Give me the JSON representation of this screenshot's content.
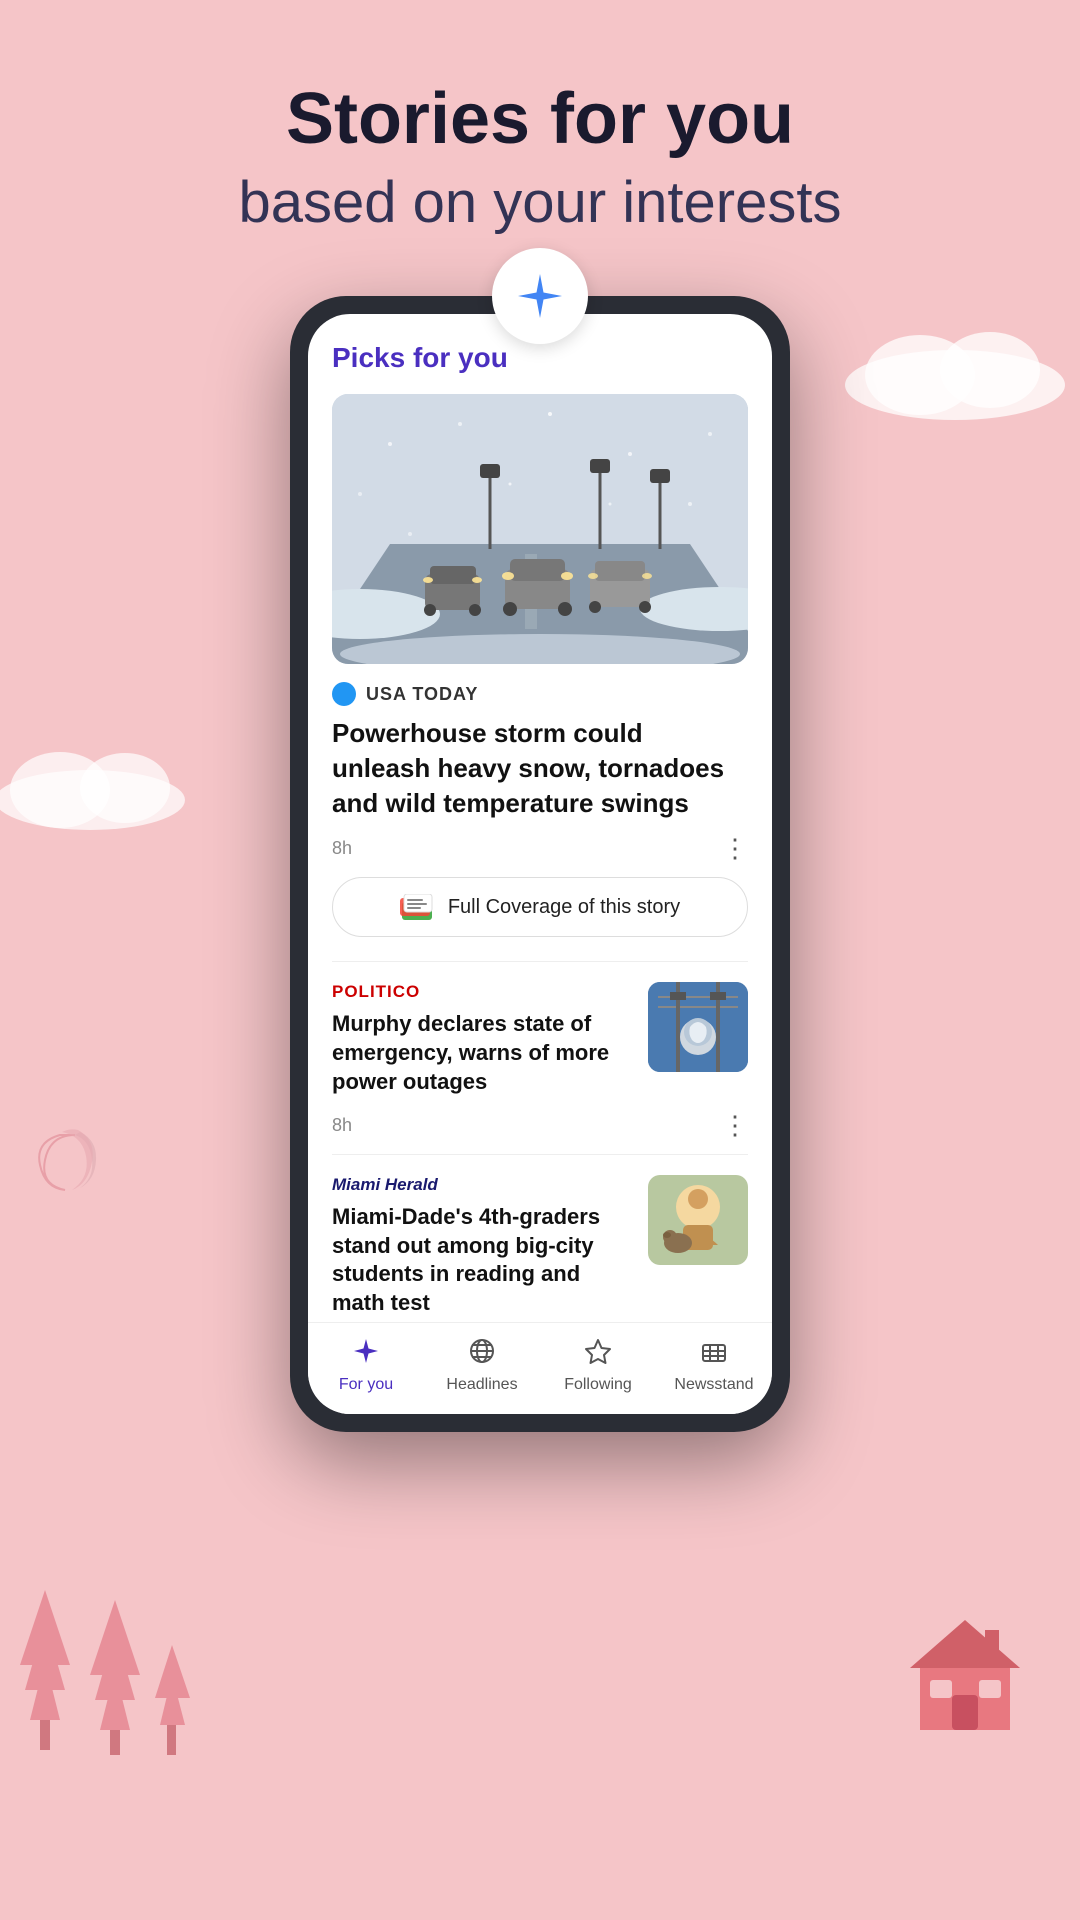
{
  "header": {
    "title_line1": "Stories for you",
    "title_line2": "based on your interests"
  },
  "phone": {
    "badge_icon": "sparkle-star"
  },
  "app": {
    "picks_title": "Picks for you",
    "hero_article": {
      "source": "USA TODAY",
      "headline": "Powerhouse storm could unleash heavy snow, tornadoes and wild temperature swings",
      "time": "8h",
      "full_coverage_label": "Full Coverage of this story"
    },
    "articles": [
      {
        "source": "POLITICO",
        "headline": "Murphy declares state of emergency, warns of more power outages",
        "time": "8h",
        "has_image": true
      },
      {
        "source": "Miami Herald",
        "headline": "Miami-Dade's 4th-graders stand out among big-city students in reading and math test",
        "time": "",
        "has_image": true
      }
    ]
  },
  "bottom_nav": {
    "items": [
      {
        "label": "For you",
        "icon": "diamond",
        "active": true
      },
      {
        "label": "Headlines",
        "icon": "globe",
        "active": false
      },
      {
        "label": "Following",
        "icon": "star",
        "active": false
      },
      {
        "label": "Newsstand",
        "icon": "bars",
        "active": false
      }
    ]
  }
}
